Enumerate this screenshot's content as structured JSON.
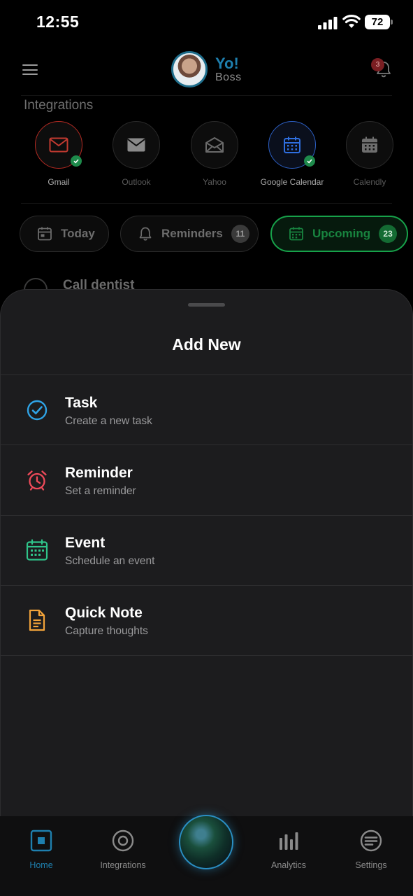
{
  "status_bar": {
    "time": "12:55",
    "battery": "72"
  },
  "header": {
    "greeting": "Yo!",
    "name": "Boss",
    "notification_count": "3"
  },
  "integrations": {
    "title": "Integrations",
    "items": [
      {
        "label": "Gmail",
        "connected": true,
        "color": "#d9342b"
      },
      {
        "label": "Outlook",
        "connected": false,
        "color": "#8a8a8a"
      },
      {
        "label": "Yahoo",
        "connected": false,
        "color": "#6a6a6a"
      },
      {
        "label": "Google Calendar",
        "connected": true,
        "color": "#2f6fe0"
      },
      {
        "label": "Calendly",
        "connected": false,
        "color": "#7a7a7a"
      }
    ]
  },
  "filters": [
    {
      "label": "Today",
      "count": ""
    },
    {
      "label": "Reminders",
      "count": "11"
    },
    {
      "label": "Upcoming",
      "count": "23",
      "active": true
    }
  ],
  "background_task": {
    "title": "Call dentist"
  },
  "sheet": {
    "title": "Add New",
    "options": [
      {
        "title": "Task",
        "subtitle": "Create a new task",
        "icon": "check-circle-icon",
        "color": "#2fa3e6"
      },
      {
        "title": "Reminder",
        "subtitle": "Set a reminder",
        "icon": "alarm-clock-icon",
        "color": "#ef4a5a"
      },
      {
        "title": "Event",
        "subtitle": "Schedule an event",
        "icon": "calendar-icon",
        "color": "#2fc48a"
      },
      {
        "title": "Quick Note",
        "subtitle": "Capture thoughts",
        "icon": "document-icon",
        "color": "#f2a33a"
      }
    ]
  },
  "nav": {
    "items": [
      {
        "label": "Home",
        "active": true
      },
      {
        "label": "Integrations"
      },
      {
        "label": "Analytics"
      },
      {
        "label": "Settings"
      }
    ]
  }
}
